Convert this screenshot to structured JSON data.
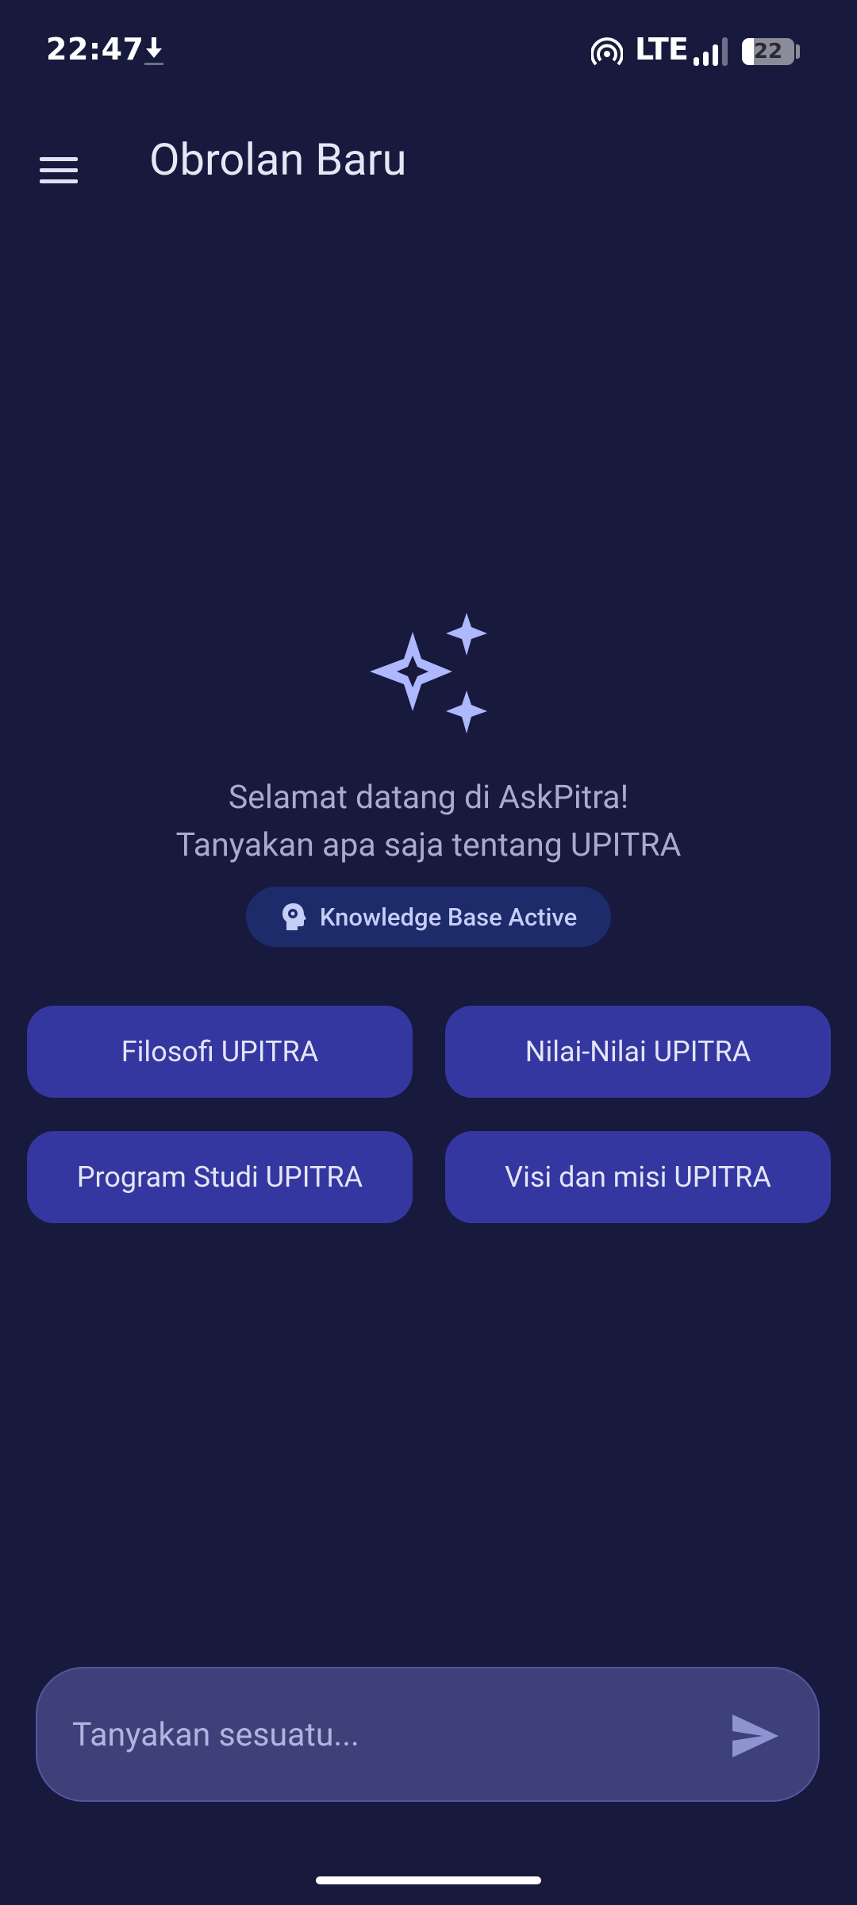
{
  "status_bar": {
    "time": "22:47",
    "network": "LTE",
    "battery": "22",
    "battery_fraction": 0.22,
    "icons": [
      "download-icon",
      "hotspot-icon",
      "signal-icon",
      "battery-icon"
    ]
  },
  "app_bar": {
    "title": "Obrolan Baru",
    "menu_icon": "hamburger-menu-icon"
  },
  "welcome": {
    "icon": "sparkle-icon",
    "line1": "Selamat datang di AskPitra!",
    "line2": "Tanyakan apa saja tentang UPITRA"
  },
  "knowledge_badge": {
    "icon": "brain-icon",
    "label": "Knowledge Base Active"
  },
  "suggestions": [
    {
      "label": "Filosofi UPITRA"
    },
    {
      "label": "Nilai-Nilai UPITRA"
    },
    {
      "label": "Program Studi UPITRA"
    },
    {
      "label": "Visi dan misi UPITRA"
    }
  ],
  "input": {
    "placeholder": "Tanyakan sesuatu...",
    "value": "",
    "send_icon": "send-icon"
  },
  "colors": {
    "background": "#17193d",
    "chip": "#3537a0",
    "badge": "#1e2b6b",
    "accent": "#aeb8ff",
    "input_bar": "#3e4179"
  }
}
